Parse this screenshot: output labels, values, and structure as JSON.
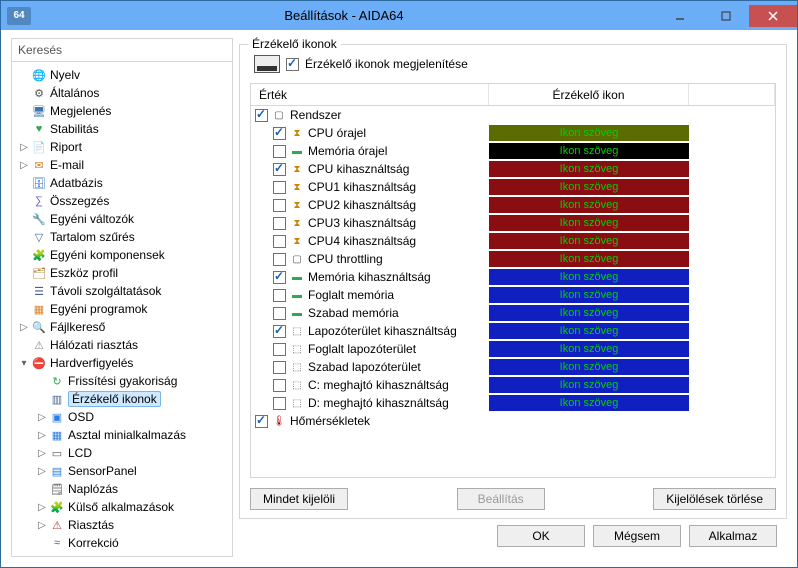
{
  "titlebar": {
    "icon_text": "64",
    "title": "Beállítások - AIDA64"
  },
  "search_label": "Keresés",
  "tree": [
    {
      "label": "Nyelv",
      "icon": "globe",
      "depth": 0,
      "exp": ""
    },
    {
      "label": "Általános",
      "icon": "gear",
      "depth": 0,
      "exp": ""
    },
    {
      "label": "Megjelenés",
      "icon": "monitor",
      "depth": 0,
      "exp": ""
    },
    {
      "label": "Stabilitás",
      "icon": "heart",
      "depth": 0,
      "exp": ""
    },
    {
      "label": "Riport",
      "icon": "report",
      "depth": 0,
      "exp": "▷"
    },
    {
      "label": "E-mail",
      "icon": "mail",
      "depth": 0,
      "exp": "▷"
    },
    {
      "label": "Adatbázis",
      "icon": "db",
      "depth": 0,
      "exp": ""
    },
    {
      "label": "Összegzés",
      "icon": "sum",
      "depth": 0,
      "exp": ""
    },
    {
      "label": "Egyéni változók",
      "icon": "var",
      "depth": 0,
      "exp": ""
    },
    {
      "label": "Tartalom szűrés",
      "icon": "filter",
      "depth": 0,
      "exp": ""
    },
    {
      "label": "Egyéni komponensek",
      "icon": "comp",
      "depth": 0,
      "exp": ""
    },
    {
      "label": "Eszköz profil",
      "icon": "profile",
      "depth": 0,
      "exp": ""
    },
    {
      "label": "Távoli szolgáltatások",
      "icon": "remote",
      "depth": 0,
      "exp": ""
    },
    {
      "label": "Egyéni programok",
      "icon": "prog",
      "depth": 0,
      "exp": ""
    },
    {
      "label": "Fájlkereső",
      "icon": "find",
      "depth": 0,
      "exp": "▷"
    },
    {
      "label": "Hálózati riasztás",
      "icon": "net",
      "depth": 0,
      "exp": ""
    },
    {
      "label": "Hardverfigyelés",
      "icon": "block",
      "depth": 0,
      "exp": "▾"
    },
    {
      "label": "Frissítési gyakoriság",
      "icon": "refresh",
      "depth": 1,
      "exp": ""
    },
    {
      "label": "Érzékelő ikonok",
      "icon": "sensor",
      "depth": 1,
      "exp": "",
      "selected": true
    },
    {
      "label": "OSD",
      "icon": "osd",
      "depth": 1,
      "exp": "▷"
    },
    {
      "label": "Asztal minialkalmazás",
      "icon": "widget",
      "depth": 1,
      "exp": "▷"
    },
    {
      "label": "LCD",
      "icon": "lcd",
      "depth": 1,
      "exp": "▷"
    },
    {
      "label": "SensorPanel",
      "icon": "panel",
      "depth": 1,
      "exp": "▷"
    },
    {
      "label": "Naplózás",
      "icon": "log",
      "depth": 1,
      "exp": ""
    },
    {
      "label": "Külső alkalmazások",
      "icon": "ext",
      "depth": 1,
      "exp": "▷"
    },
    {
      "label": "Riasztás",
      "icon": "alert",
      "depth": 1,
      "exp": "▷"
    },
    {
      "label": "Korrekció",
      "icon": "corr",
      "depth": 1,
      "exp": ""
    }
  ],
  "groupbox_title": "Érzékelő ikonok",
  "show_sensors_label": "Érzékelő ikonok megjelenítése",
  "show_sensors_checked": true,
  "columns": {
    "value": "Érték",
    "icon": "Érzékelő ikon"
  },
  "badge_text": "Ikon szöveg",
  "rows": [
    {
      "type": "group",
      "label": "Rendszer",
      "checked": true,
      "icon": "cpu",
      "depth": 0
    },
    {
      "type": "item",
      "label": "CPU órajel",
      "checked": true,
      "icon": "clock",
      "bg": "#5b6b00",
      "fg": "#00d000",
      "depth": 1
    },
    {
      "type": "item",
      "label": "Memória órajel",
      "checked": false,
      "icon": "mem",
      "bg": "#000000",
      "fg": "#00d000",
      "depth": 1
    },
    {
      "type": "item",
      "label": "CPU kihasználtság",
      "checked": true,
      "icon": "clock",
      "bg": "#8a0d12",
      "fg": "#00d000",
      "depth": 1
    },
    {
      "type": "item",
      "label": "CPU1 kihasználtság",
      "checked": false,
      "icon": "clock",
      "bg": "#8a0d12",
      "fg": "#00d000",
      "depth": 1
    },
    {
      "type": "item",
      "label": "CPU2 kihasználtság",
      "checked": false,
      "icon": "clock",
      "bg": "#8a0d12",
      "fg": "#00d000",
      "depth": 1
    },
    {
      "type": "item",
      "label": "CPU3 kihasználtság",
      "checked": false,
      "icon": "clock",
      "bg": "#8a0d12",
      "fg": "#00d000",
      "depth": 1
    },
    {
      "type": "item",
      "label": "CPU4 kihasználtság",
      "checked": false,
      "icon": "clock",
      "bg": "#8a0d12",
      "fg": "#00d000",
      "depth": 1
    },
    {
      "type": "item",
      "label": "CPU throttling",
      "checked": false,
      "icon": "cpu",
      "bg": "#8a0d12",
      "fg": "#00d000",
      "depth": 1
    },
    {
      "type": "item",
      "label": "Memória kihasználtság",
      "checked": true,
      "icon": "mem",
      "bg": "#1020c0",
      "fg": "#00d000",
      "depth": 1
    },
    {
      "type": "item",
      "label": "Foglalt memória",
      "checked": false,
      "icon": "mem",
      "bg": "#1020c0",
      "fg": "#00d000",
      "depth": 1
    },
    {
      "type": "item",
      "label": "Szabad memória",
      "checked": false,
      "icon": "mem",
      "bg": "#1020c0",
      "fg": "#00d000",
      "depth": 1
    },
    {
      "type": "item",
      "label": "Lapozóterület kihasználtság",
      "checked": true,
      "icon": "disk",
      "bg": "#1020c0",
      "fg": "#00d000",
      "depth": 1
    },
    {
      "type": "item",
      "label": "Foglalt lapozóterület",
      "checked": false,
      "icon": "disk",
      "bg": "#1020c0",
      "fg": "#00d000",
      "depth": 1
    },
    {
      "type": "item",
      "label": "Szabad lapozóterület",
      "checked": false,
      "icon": "disk",
      "bg": "#1020c0",
      "fg": "#00d000",
      "depth": 1
    },
    {
      "type": "item",
      "label": "C: meghajtó kihasználtság",
      "checked": false,
      "icon": "disk",
      "bg": "#1020c0",
      "fg": "#00d000",
      "depth": 1
    },
    {
      "type": "item",
      "label": "D: meghajtó kihasználtság",
      "checked": false,
      "icon": "disk",
      "bg": "#1020c0",
      "fg": "#00d000",
      "depth": 1
    },
    {
      "type": "group",
      "label": "Hőmérsékletek",
      "checked": true,
      "icon": "therm",
      "depth": 0
    }
  ],
  "buttons": {
    "select_all": "Mindet kijelöli",
    "config": "Beállítás",
    "clear": "Kijelölések törlése",
    "ok": "OK",
    "cancel": "Mégsem",
    "apply": "Alkalmaz"
  }
}
